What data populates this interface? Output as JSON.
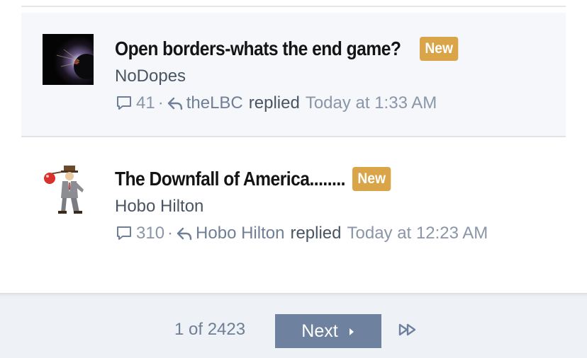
{
  "threads": [
    {
      "title": "Open borders-whats the end game?",
      "badge": "New",
      "author": "NoDopes",
      "replies": "41",
      "separator": "·",
      "last_replier": "theLBC",
      "reply_verb": "replied",
      "time": "Today at 1:33 AM"
    },
    {
      "title": "The Downfall of America........",
      "badge": "New",
      "author": "Hobo Hilton",
      "replies": "310",
      "separator": "·",
      "last_replier": "Hobo Hilton",
      "reply_verb": "replied",
      "time": "Today at 12:23 AM"
    }
  ],
  "pagination": {
    "page_info": "1 of 2423",
    "next_label": "Next"
  },
  "icons": {
    "replies": "speech-bubble-icon",
    "reply": "reply-arrow-icon",
    "next": "caret-right-icon",
    "last": "double-triangle-right-icon"
  },
  "colors": {
    "badge": "#d9a548",
    "next_button": "#6e82a0",
    "muted_text": "#8a96a8",
    "title_text": "#141414"
  }
}
